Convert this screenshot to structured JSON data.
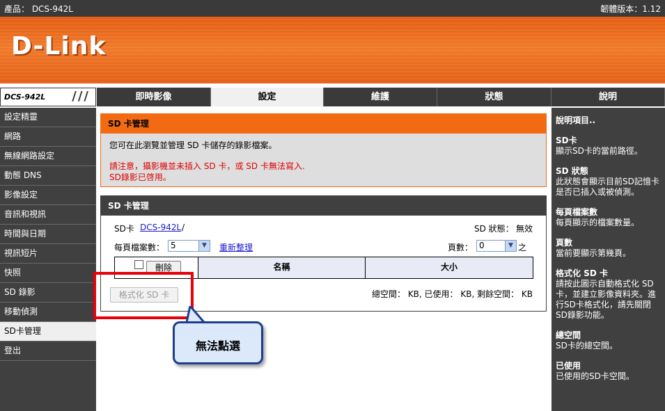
{
  "topbar": {
    "product": "產品： DCS-942L",
    "firmware": "韌體版本：1.12"
  },
  "brand": {
    "logo": "D-Link",
    "model": "DCS-942L",
    "slashes": "///"
  },
  "nav": {
    "tabs": [
      "即時影像",
      "設定",
      "維護",
      "狀態",
      "說明"
    ],
    "active": "設定"
  },
  "sidebar": {
    "items": [
      "設定精靈",
      "網路",
      "無線網路設定",
      "動態 DNS",
      "影像設定",
      "音訊和視訊",
      "時間與日期",
      "視訊短片",
      "快照",
      "SD 錄影",
      "移動偵測",
      "SD卡管理",
      "登出"
    ],
    "active": "SD卡管理"
  },
  "section1": {
    "title": "SD 卡管理",
    "description": "您可在此瀏覽並管理 SD 卡儲存的錄影檔案。",
    "warning1": "請注意，攝影機並未插入 SD 卡，或 SD 卡無法寫入.",
    "warning2": "SD錄影已啓用。"
  },
  "section2": {
    "title": "SD 卡管理",
    "path_label": "SD卡",
    "path_link": "DCS-942L",
    "path_sep": "/",
    "status_label": "SD 狀態：",
    "status_value": "無效",
    "per_page_label": "每頁檔案數：",
    "per_page_value": "5",
    "refresh_link": "重新整理",
    "page_label": "頁數：",
    "page_value": "0",
    "page_suffix": "之",
    "delete_button": "刪除",
    "col_name": "名稱",
    "col_size": "大小",
    "format_button": "格式化 SD 卡",
    "space_info": "總空間： KB, 已使用： KB, 剩餘空間： KB"
  },
  "callout": {
    "text": "無法點選"
  },
  "help": {
    "title": "說明項目..",
    "sections": [
      {
        "head": "SD卡",
        "body": "顯示SD卡的當前路徑。"
      },
      {
        "head": "SD 狀態",
        "body": "此狀態會顯示目前SD記憶卡是否已插入或被偵測。"
      },
      {
        "head": "每頁檔案數",
        "body": "每頁顯示的檔案數量。"
      },
      {
        "head": "頁數",
        "body": "當前要顯示第幾頁。"
      },
      {
        "head": "格式化 SD 卡",
        "body": "請按此圖示自動格式化 SD 卡，並建立影像資料夾。進行SD卡格式化，請先關閉SD錄影功能。"
      },
      {
        "head": "總空間",
        "body": "SD卡的總空間。"
      },
      {
        "head": "已使用",
        "body": "已使用的SD卡空間。"
      }
    ]
  },
  "colors": {
    "accent": "#f26b13",
    "dark": "#404040",
    "warning": "#dd0000",
    "highlight": "#e8000a",
    "callout_border": "#1e3d8f"
  }
}
